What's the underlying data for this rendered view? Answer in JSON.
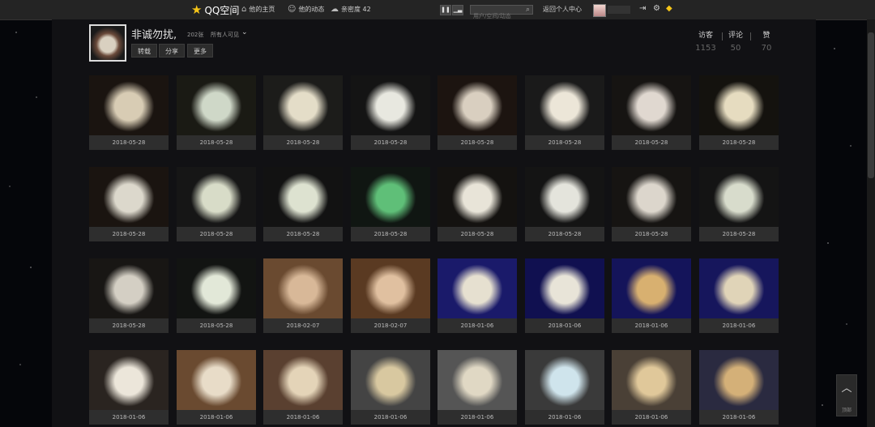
{
  "topbar": {
    "logo_text": "QQ空间",
    "nav": [
      "他的主页",
      "他的动态",
      "亲密度 42"
    ],
    "search_placeholder": "用户/空间/动态",
    "back_label": "返回个人中心"
  },
  "album": {
    "title": "非诚勿扰,",
    "count": "202张",
    "visibility": "所有人可见",
    "buttons": [
      "转载",
      "分享",
      "更多"
    ],
    "stats": [
      {
        "label": "访客",
        "value": "1153"
      },
      {
        "label": "评论",
        "value": "50"
      },
      {
        "label": "赞",
        "value": "70"
      }
    ]
  },
  "photos": [
    {
      "date": "2018-05-28",
      "tone": [
        "#1a1410",
        "#d8ccb4"
      ]
    },
    {
      "date": "2018-05-28",
      "tone": [
        "#1a1a14",
        "#cfd8c8"
      ]
    },
    {
      "date": "2018-05-28",
      "tone": [
        "#1c1c1a",
        "#e4ddc8"
      ]
    },
    {
      "date": "2018-05-28",
      "tone": [
        "#141414",
        "#e8e8e0"
      ]
    },
    {
      "date": "2018-05-28",
      "tone": [
        "#1c1410",
        "#d9cfc0"
      ]
    },
    {
      "date": "2018-05-28",
      "tone": [
        "#1a1a1a",
        "#ece6d8"
      ]
    },
    {
      "date": "2018-05-28",
      "tone": [
        "#161412",
        "#e0d8d0"
      ]
    },
    {
      "date": "2018-05-28",
      "tone": [
        "#14120e",
        "#e6dcc0"
      ]
    },
    {
      "date": "2018-05-28",
      "tone": [
        "#1a1410",
        "#dcd8cc"
      ]
    },
    {
      "date": "2018-05-28",
      "tone": [
        "#161616",
        "#d8dcc8"
      ]
    },
    {
      "date": "2018-05-28",
      "tone": [
        "#121212",
        "#dde2d0"
      ]
    },
    {
      "date": "2018-05-28",
      "tone": [
        "#101612",
        "#5fbf78"
      ]
    },
    {
      "date": "2018-05-28",
      "tone": [
        "#141210",
        "#e8e4d8"
      ]
    },
    {
      "date": "2018-05-28",
      "tone": [
        "#141414",
        "#e4e4dc"
      ]
    },
    {
      "date": "2018-05-28",
      "tone": [
        "#161412",
        "#dcd6cc"
      ]
    },
    {
      "date": "2018-05-28",
      "tone": [
        "#141414",
        "#d8dccc"
      ]
    },
    {
      "date": "2018-05-28",
      "tone": [
        "#181614",
        "#d4cfc4"
      ]
    },
    {
      "date": "2018-05-28",
      "tone": [
        "#121412",
        "#e2e8d8"
      ]
    },
    {
      "date": "2018-02-07",
      "tone": [
        "#6a4a30",
        "#d8b898"
      ]
    },
    {
      "date": "2018-02-07",
      "tone": [
        "#5a3a22",
        "#e0c0a0"
      ]
    },
    {
      "date": "2018-01-06",
      "tone": [
        "#1a1a6a",
        "#e6e0d0"
      ]
    },
    {
      "date": "2018-01-06",
      "tone": [
        "#101050",
        "#e8e4d8"
      ]
    },
    {
      "date": "2018-01-06",
      "tone": [
        "#14145a",
        "#d8b070"
      ]
    },
    {
      "date": "2018-01-06",
      "tone": [
        "#16165c",
        "#e0d4b8"
      ]
    },
    {
      "date": "2018-01-06",
      "tone": [
        "#2a2420",
        "#ece6da"
      ]
    },
    {
      "date": "2018-01-06",
      "tone": [
        "#6a4a30",
        "#e8dcc8"
      ]
    },
    {
      "date": "2018-01-06",
      "tone": [
        "#5a4030",
        "#e4d4b8"
      ]
    },
    {
      "date": "2018-01-06",
      "tone": [
        "#444444",
        "#d8c8a0"
      ]
    },
    {
      "date": "2018-01-06",
      "tone": [
        "#555555",
        "#e0d8c4"
      ]
    },
    {
      "date": "2018-01-06",
      "tone": [
        "#3a3a3a",
        "#cfe4ec"
      ]
    },
    {
      "date": "2018-01-06",
      "tone": [
        "#4a4036",
        "#e0c89a"
      ]
    },
    {
      "date": "2018-01-06",
      "tone": [
        "#2a2a40",
        "#d4b078"
      ]
    }
  ],
  "totop_label": "顶部"
}
